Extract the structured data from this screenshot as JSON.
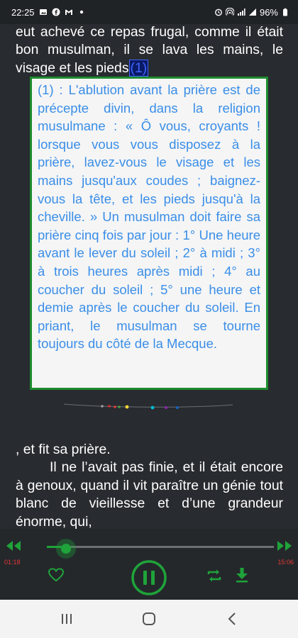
{
  "status_bar": {
    "time": "22:25",
    "battery": "96%",
    "left_icons": [
      "gallery-icon",
      "facebook-icon",
      "gmail-icon",
      "dot-icon"
    ],
    "right_icons": [
      "alarm-icon",
      "hotspot-icon",
      "signal-icon",
      "wifi-signal-icon"
    ]
  },
  "reader": {
    "text_top": "eut achevé ce repas frugal, comme il était bon musulman, il se lava les mains, le visage et les pieds",
    "footnote_ref": "(1)",
    "footnote_text": "(1) : L'ablution avant la prière est de précepte divin, dans la religion musulmane : « Ô vous, croyants ! lorsque vous vous disposez à la prière, lavez-vous le visage et les mains jusqu'aux coudes ; baignez-vous la tête, et les pieds jusqu'à la cheville. » Un musulman doit faire sa prière cinq fois par jour : 1° Une heure avant le lever du soleil ; 2° à midi ; 3° à trois heures après midi ; 4° au coucher du soleil ; 5° une heure et demie après le coucher du soleil. En priant, le musulman se tourne toujours du côté de la Mecque.",
    "text_after_fn": ", et fit sa prière.",
    "text_paragraph": "Il ne l’avait pas finie, et il était encore à genoux, quand il vit paraître un génie tout blanc de vieillesse et d’une grandeur énorme, qui,"
  },
  "player": {
    "current_time": "01:18",
    "total_time": "15:06",
    "progress": 0.085,
    "accent_color": "#1fa33a",
    "time_color": "#e53935"
  },
  "nav_bar": {
    "icons": [
      "recents-icon",
      "home-icon",
      "back-icon"
    ]
  }
}
